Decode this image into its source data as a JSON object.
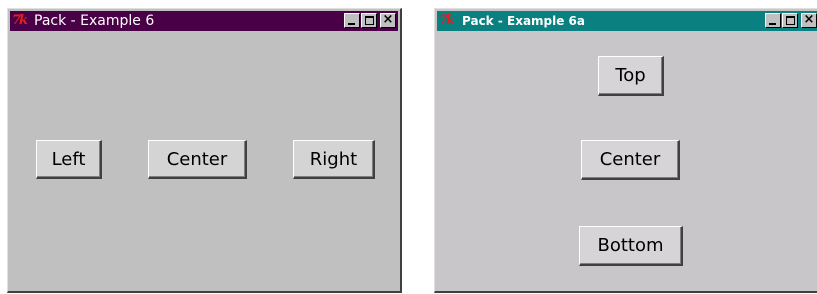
{
  "window1": {
    "title": "Pack - Example 6",
    "logo": "7k",
    "buttons": {
      "left": "Left",
      "center": "Center",
      "right": "Right"
    },
    "titlebar_color": "#4a0047"
  },
  "window2": {
    "title": "Pack - Example 6a",
    "logo": "7k",
    "buttons": {
      "top": "Top",
      "center": "Center",
      "bottom": "Bottom"
    },
    "titlebar_color": "#0a8080"
  },
  "controls": {
    "minimize_icon": "minimize-icon",
    "maximize_icon": "maximize-icon",
    "close_icon": "close-icon",
    "close_glyph": "×"
  }
}
